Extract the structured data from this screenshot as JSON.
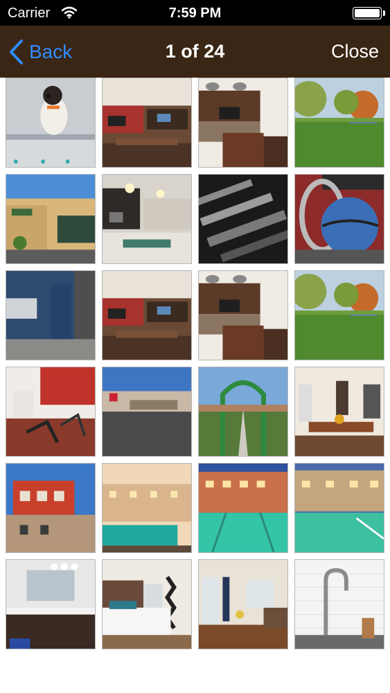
{
  "status_bar": {
    "carrier": "Carrier",
    "time": "7:59 PM"
  },
  "nav": {
    "back_label": "Back",
    "title": "1 of 24",
    "close_label": "Close"
  },
  "gallery": {
    "photos": [
      {
        "subject": "dog-grooming"
      },
      {
        "subject": "clubhouse-lounge"
      },
      {
        "subject": "clubhouse-kitchen"
      },
      {
        "subject": "lawn-with-trees"
      },
      {
        "subject": "grocery-store-exterior"
      },
      {
        "subject": "kitchen-interior"
      },
      {
        "subject": "gym-equipment-handles"
      },
      {
        "subject": "medicine-ball"
      },
      {
        "subject": "pet-wash-room"
      },
      {
        "subject": "clubhouse-lounge"
      },
      {
        "subject": "clubhouse-kitchen"
      },
      {
        "subject": "lawn-with-trees"
      },
      {
        "subject": "fitness-center"
      },
      {
        "subject": "shopping-center"
      },
      {
        "subject": "garden-arbor"
      },
      {
        "subject": "dining-room"
      },
      {
        "subject": "building-exterior"
      },
      {
        "subject": "pool-at-dusk"
      },
      {
        "subject": "pool-with-buildings"
      },
      {
        "subject": "pool-at-night"
      },
      {
        "subject": "bathroom"
      },
      {
        "subject": "bedroom"
      },
      {
        "subject": "living-room"
      },
      {
        "subject": "kitchen-faucet"
      }
    ]
  }
}
